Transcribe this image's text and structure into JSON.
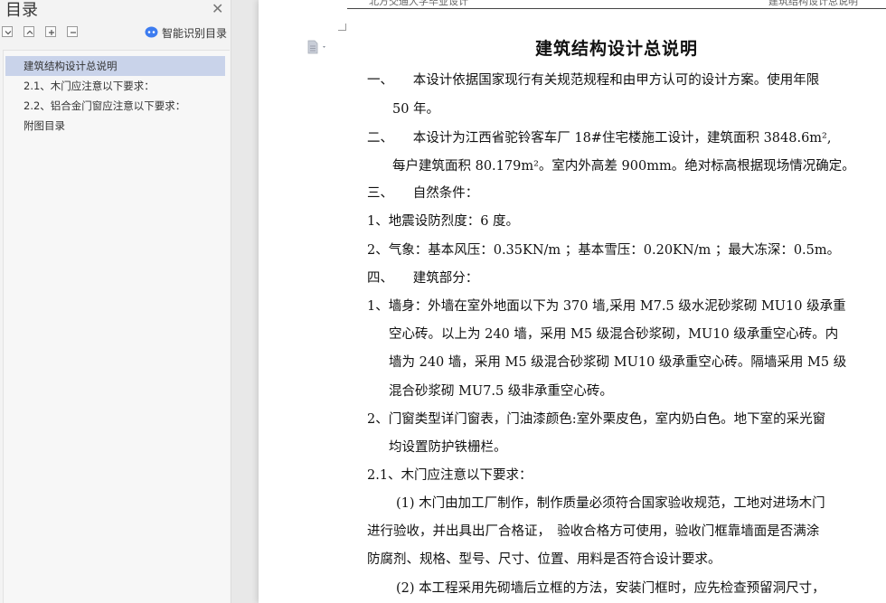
{
  "sidebar": {
    "title": "目录",
    "smart_toc_label": "智能识别目录",
    "items": [
      {
        "label": "建筑结构设计总说明"
      },
      {
        "label": "2.1、木门应注意以下要求："
      },
      {
        "label": "2.2、铝合金门窗应注意以下要求："
      },
      {
        "label": "附图目录"
      }
    ]
  },
  "header": {
    "left": "北方交通大学毕业设计",
    "right": "建筑结构设计总说明"
  },
  "document": {
    "title": "建筑结构设计总说明",
    "lines": [
      "一、　　本设计依据国家现行有关规范规程和由甲方认可的设计方案。使用年限",
      "50 年。",
      "二、　　本设计为江西省驼铃客车厂 18#住宅楼施工设计，建筑面积 3848.6m²,",
      "每户建筑面积 80.179m²。室内外高差 900mm。绝对标高根据现场情况确定。",
      "三、　　自然条件：",
      "1、地震设防烈度：6 度。",
      "2、气象：基本风压：0.35KN/m ；基本雪压：0.20KN/m ；最大冻深：0.5m。",
      "四、　　建筑部分：",
      "1、墙身：外墙在室外地面以下为 370 墙,采用 M7.5 级水泥砂浆砌 MU10 级承重",
      "空心砖。以上为 240 墙，采用 M5 级混合砂浆砌，MU10 级承重空心砖。内",
      "墙为 240 墙，采用 M5 级混合砂浆砌 MU10 级承重空心砖。隔墙采用 M5 级",
      "混合砂浆砌 MU7.5 级非承重空心砖。",
      "2、门窗类型详门窗表，门油漆颜色:室外栗皮色，室内奶白色。地下室的采光窗",
      "均设置防护铁栅栏。",
      "2.1、木门应注意以下要求：",
      "(1) 木门由加工厂制作，制作质量必须符合国家验收规范，工地对进场木门",
      "进行验收，并出具出厂合格证，　验收合格方可使用，验收门框靠墙面是否满涂",
      "防腐剂、规格、型号、尺寸、位置、用料是否符合设计要求。",
      "(2) 本工程采用先砌墙后立框的方法，安装门框时，应先检查预留洞尺寸，"
    ]
  },
  "colors": {
    "sidebar_bg": "#f3f3f3",
    "active_item_bg": "#c9d3ea",
    "smart_icon": "#3d7cf0"
  }
}
